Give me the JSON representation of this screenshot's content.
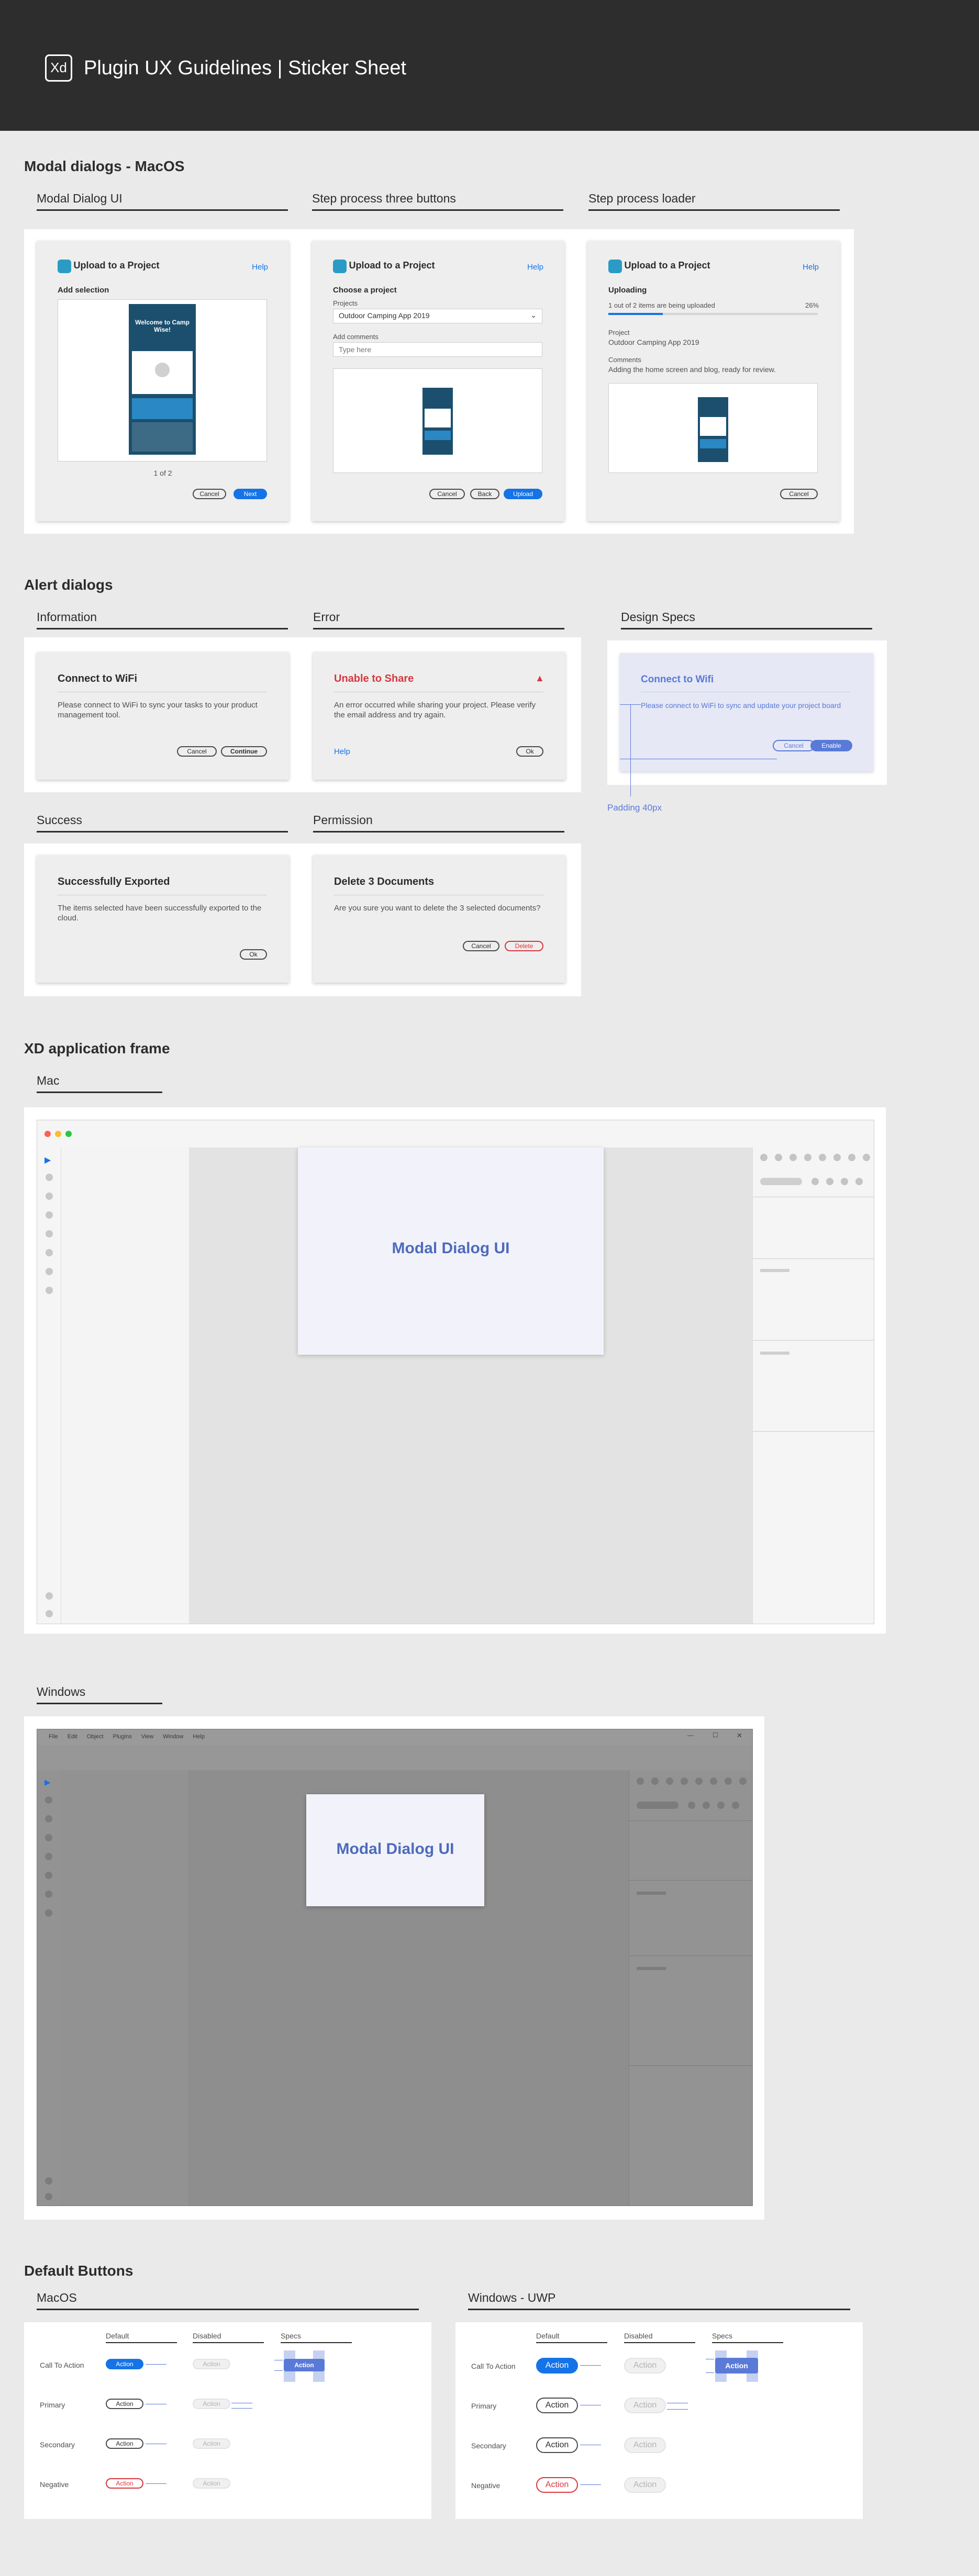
{
  "header": {
    "logo": "Xd",
    "title": "Plugin UX Guidelines  |  Sticker Sheet"
  },
  "modal": {
    "section": "Modal dialogs - MacOS",
    "groups": [
      "Modal Dialog UI",
      "Step process three buttons",
      "Step process loader"
    ],
    "title": "Upload to a Project",
    "help": "Help",
    "card1": {
      "heading": "Add selection",
      "phone_welcome": "Welcome to Camp Wise!",
      "pager": "1 of 2",
      "cancel": "Cancel",
      "next": "Next"
    },
    "card2": {
      "heading": "Choose a project",
      "projects_label": "Projects",
      "project_value": "Outdoor Camping App 2019",
      "comments_label": "Add comments",
      "comments_placeholder": "Type here",
      "cancel": "Cancel",
      "back": "Back",
      "upload": "Upload"
    },
    "card3": {
      "heading": "Uploading",
      "progress_text": "1 out of 2 items are being uploaded",
      "progress_pct": "26%",
      "progress": 0.26,
      "project_label": "Project",
      "project_value": "Outdoor Camping App 2019",
      "comments_label": "Comments",
      "comments_value": "Adding the home screen and blog, ready for review.",
      "cancel": "Cancel"
    }
  },
  "alert": {
    "section": "Alert dialogs",
    "groups": [
      "Information",
      "Error",
      "Design Specs",
      "Success",
      "Permission"
    ],
    "info": {
      "title": "Connect to WiFi",
      "text": "Please connect to WiFi to sync your tasks to your product management tool.",
      "cancel": "Cancel",
      "continue": "Continue"
    },
    "error": {
      "title": "Unable to Share",
      "text": "An error occurred while sharing your project. Please verify the email address and try again.",
      "help": "Help",
      "ok": "Ok"
    },
    "specs": {
      "title": "Connect to Wifi",
      "text": "Please connect to WiFi to sync and update your project board",
      "cancel": "Cancel",
      "enable": "Enable",
      "padding": "Padding 40px"
    },
    "success": {
      "title": "Successfully Exported",
      "text": "The items selected have been successfully exported to the cloud.",
      "ok": "Ok"
    },
    "permission": {
      "title": "Delete 3 Documents",
      "text": "Are you sure you want to delete the 3 selected documents?",
      "cancel": "Cancel",
      "delete": "Delete"
    }
  },
  "frame": {
    "section": "XD application frame",
    "mac_label": "Mac",
    "windows_label": "Windows",
    "modal_label": "Modal Dialog UI",
    "win_menu": [
      "File",
      "Edit",
      "Object",
      "Plugins",
      "View",
      "Window",
      "Help"
    ]
  },
  "buttons": {
    "section": "Default Buttons",
    "macos": "MacOS",
    "windows": "Windows - UWP",
    "cols": [
      "Default",
      "Disabled",
      "Specs"
    ],
    "rows": [
      "Call To Action",
      "Primary",
      "Secondary",
      "Negative"
    ],
    "action": "Action"
  },
  "colors": {
    "accent": "#1473e6",
    "negative": "#d7373f",
    "spec": "#5a7ad8",
    "header": "#2d2d2d"
  }
}
